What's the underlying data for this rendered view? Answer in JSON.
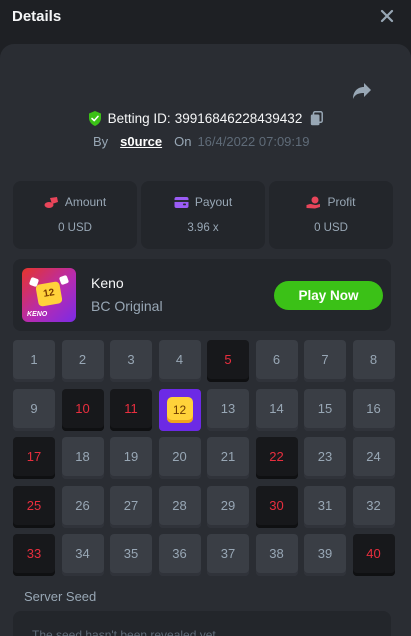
{
  "header": {
    "title": "Details"
  },
  "bet": {
    "id_label": "Betting ID:",
    "id": "39916846228439432",
    "by_label": "By",
    "user": "s0urce",
    "on_label": "On",
    "datetime": "16/4/2022 07:09:19"
  },
  "stats": [
    {
      "label": "Amount",
      "value": "0 USD",
      "icon": "coins-icon",
      "color": "#e8455a"
    },
    {
      "label": "Payout",
      "value": "3.96 x",
      "icon": "wallet-icon",
      "color": "#9b5cf5"
    },
    {
      "label": "Profit",
      "value": "0 USD",
      "icon": "profit-hand-icon",
      "color": "#e8455a"
    }
  ],
  "game": {
    "name": "Keno",
    "provider": "BC Original",
    "thumb_label": "KENO",
    "thumb_tile": "12",
    "play_label": "Play Now"
  },
  "grid": {
    "numbers": [
      "1",
      "2",
      "3",
      "4",
      "5",
      "6",
      "7",
      "8",
      "9",
      "10",
      "11",
      "12",
      "13",
      "14",
      "15",
      "16",
      "17",
      "18",
      "19",
      "20",
      "21",
      "22",
      "23",
      "24",
      "25",
      "26",
      "27",
      "28",
      "29",
      "30",
      "31",
      "32",
      "33",
      "34",
      "35",
      "36",
      "37",
      "38",
      "39",
      "40"
    ],
    "picked": [
      5,
      10,
      11,
      17,
      22,
      25,
      30,
      33,
      40
    ],
    "hit": [
      12
    ]
  },
  "seed": {
    "label": "Server Seed",
    "text": "The seed hasn't been revealed yet"
  },
  "colors": {
    "accent_green": "#3bc117",
    "picked_red": "#e82e3e",
    "hit_purple": "#6c2ae5",
    "verified_green": "#3bc117"
  }
}
